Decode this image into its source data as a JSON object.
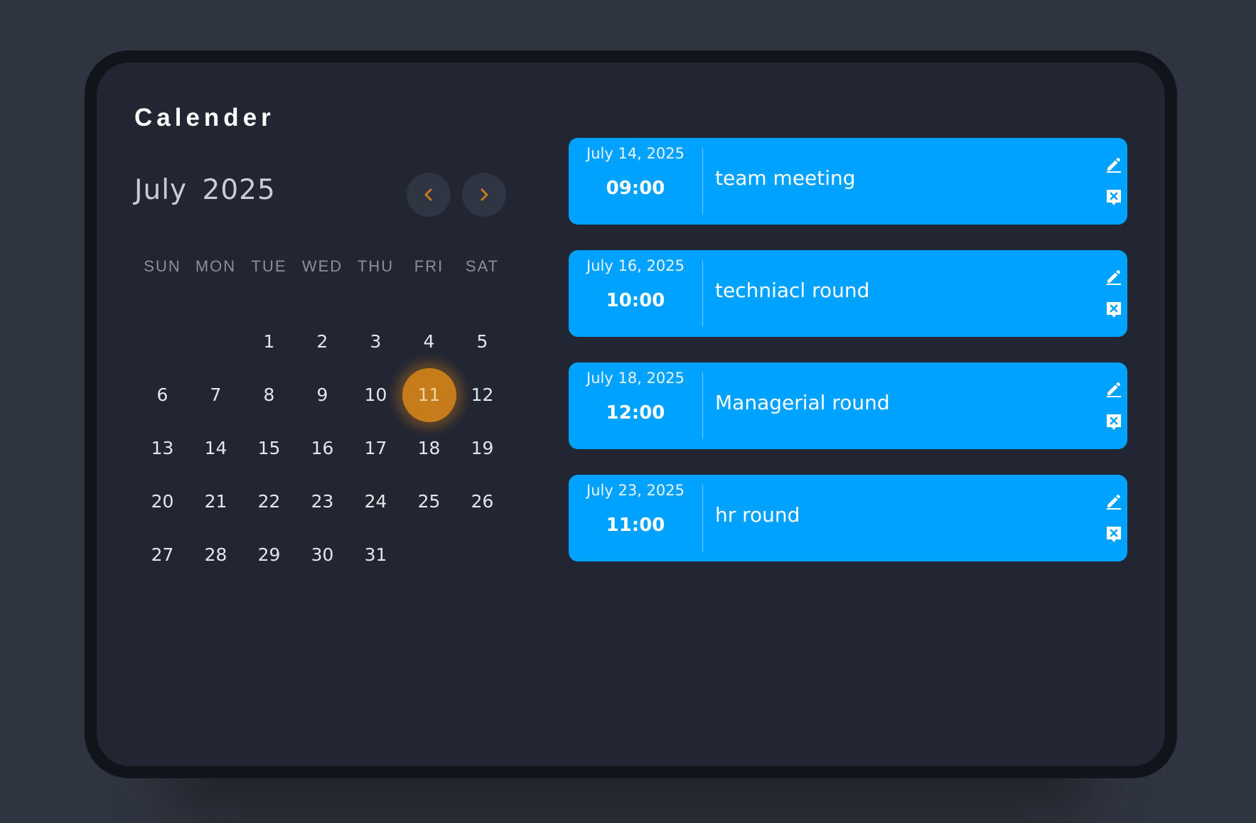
{
  "app": {
    "title": "Calender"
  },
  "calendar": {
    "month_label": "July 2025",
    "prev_icon": "chevron-left-icon",
    "next_icon": "chevron-right-icon",
    "weekdays": [
      "SUN",
      "MON",
      "TUE",
      "WED",
      "THU",
      "FRI",
      "SAT"
    ],
    "days": [
      "",
      "",
      "1",
      "2",
      "3",
      "4",
      "5",
      "6",
      "7",
      "8",
      "9",
      "10",
      "11",
      "12",
      "13",
      "14",
      "15",
      "16",
      "17",
      "18",
      "19",
      "20",
      "21",
      "22",
      "23",
      "24",
      "25",
      "26",
      "27",
      "28",
      "29",
      "30",
      "31",
      "",
      ""
    ],
    "selected_day": "11"
  },
  "events": [
    {
      "date": "July 14, 2025",
      "time": "09:00",
      "title": "team meeting",
      "edit_icon": "pencil-icon",
      "delete_icon": "delete-icon"
    },
    {
      "date": "July 16, 2025",
      "time": "10:00",
      "title": "techniacl round",
      "edit_icon": "pencil-icon",
      "delete_icon": "delete-icon"
    },
    {
      "date": "July 18, 2025",
      "time": "12:00",
      "title": "Managerial round",
      "edit_icon": "pencil-icon",
      "delete_icon": "delete-icon"
    },
    {
      "date": "July 23, 2025",
      "time": "11:00",
      "title": "hr round",
      "edit_icon": "pencil-icon",
      "delete_icon": "delete-icon"
    }
  ],
  "colors": {
    "background": "#2f3540",
    "panel": "#222633",
    "accent": "#00a2ff",
    "selected_day": "#c67c1a"
  }
}
